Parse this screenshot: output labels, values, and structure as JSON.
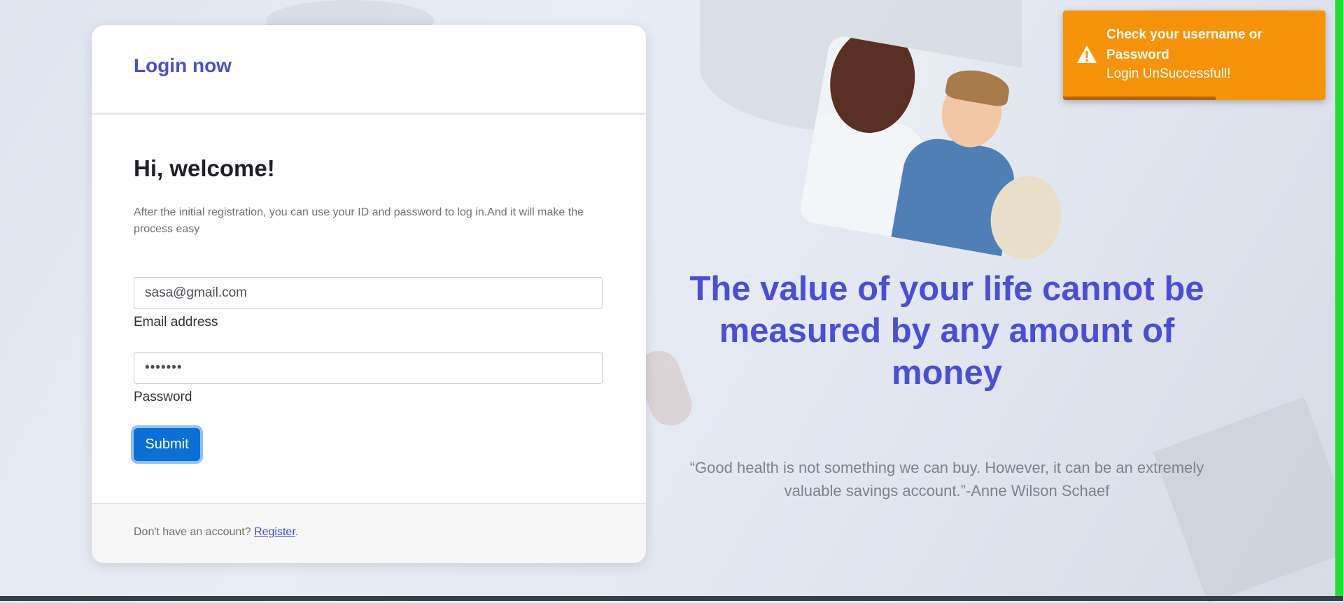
{
  "login": {
    "title": "Login now",
    "welcome": "Hi, welcome!",
    "intro": "After the initial registration, you can use your ID and password to log in.And it will make the process easy",
    "email_value": "sasa@gmail.com",
    "email_label": "Email address",
    "password_masked": "•••••••",
    "password_label": "Password",
    "submit_label": "Submit",
    "footer_text": "Don't have an account? ",
    "register_link": "Register",
    "footer_period": "."
  },
  "hero": {
    "headline_line1": "The value of your life cannot be",
    "headline_line2": "measured by any amount of money",
    "quote": "“Good health is not something we can buy. However, it can be an extremely valuable savings account.”-Anne Wilson Schaef"
  },
  "toast": {
    "title": "Check your username or Password",
    "message": "Login UnSuccessfull!",
    "icon": "warning-icon",
    "progress": 0.58,
    "color": "#f7930a"
  },
  "colors": {
    "accent": "#4a4ed6",
    "button": "#0b6fd6"
  }
}
